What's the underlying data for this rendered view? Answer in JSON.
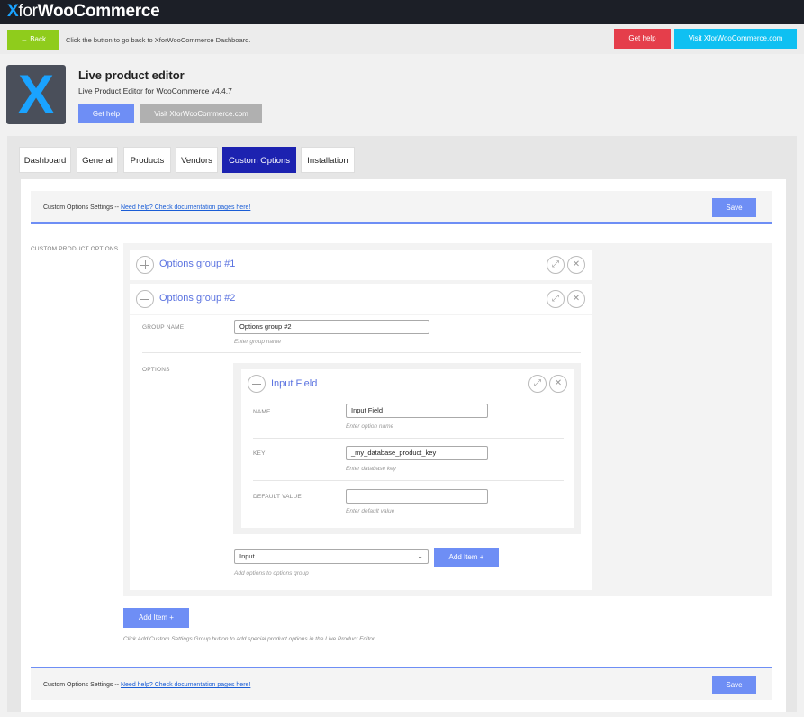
{
  "brand": {
    "x": "X",
    "for": "for",
    "name": "WooCommerce"
  },
  "actionbar": {
    "back_label": "← Back",
    "back_hint": "Click the button to go back to XforWooCommerce Dashboard.",
    "get_help_label": "Get help",
    "visit_label": "Visit XforWooCommerce.com"
  },
  "plugin": {
    "logo_letter": "X",
    "title": "Live product editor",
    "subtitle": "Live Product Editor for WooCommerce v4.4.7",
    "get_help_label": "Get help",
    "visit_label": "Visit XforWooCommerce.com"
  },
  "tabs": [
    {
      "label": "Dashboard",
      "active": false
    },
    {
      "label": "General",
      "active": false
    },
    {
      "label": "Products",
      "active": false
    },
    {
      "label": "Vendors",
      "active": false
    },
    {
      "label": "Custom Options",
      "active": true
    },
    {
      "label": "Installation",
      "active": false
    }
  ],
  "savebar": {
    "text": "Custom Options Settings --",
    "link": "Need help? Check documentation pages here!",
    "save_label": "Save"
  },
  "section_label": "CUSTOM PRODUCT OPTIONS",
  "groups": [
    {
      "title": "Options group #1",
      "expanded": false
    },
    {
      "title": "Options group #2",
      "expanded": true,
      "group_name_label": "GROUP NAME",
      "group_name_value": "Options group #2",
      "group_name_hint": "Enter group name",
      "options_label": "OPTIONS",
      "option": {
        "title": "Input Field",
        "fields": [
          {
            "label": "NAME",
            "value": "Input Field",
            "hint": "Enter option name"
          },
          {
            "label": "KEY",
            "value": "_my_database_product_key",
            "hint": "Enter database key"
          },
          {
            "label": "DEFAULT VALUE",
            "value": "",
            "hint": "Enter default value"
          }
        ]
      },
      "select_value": "Input",
      "add_item_label": "Add Item +",
      "add_hint": "Add options to options group"
    }
  ],
  "add_item_label": "Add Item +",
  "add_group_hint": "Click Add Custom Settings Group button to add special product options in the Live Product Editor.",
  "icons": {
    "expand": "expand-icon",
    "close": "close-icon",
    "plus": "plus-circle-icon",
    "minus": "minus-circle-icon",
    "chevron": "chevron-down-icon"
  },
  "colors": {
    "accent": "#6e8ef5",
    "active_tab": "#1c22b0",
    "back": "#8fcc1c",
    "danger": "#e53e4b",
    "cyan": "#0fc0f2",
    "logo_x": "#1aa3ff"
  }
}
